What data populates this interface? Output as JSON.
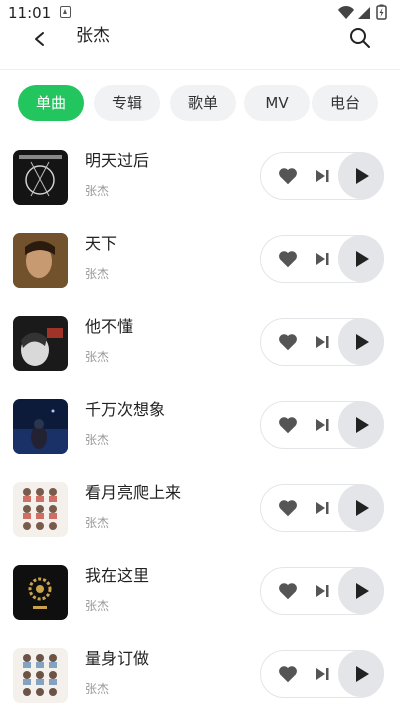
{
  "status": {
    "time": "11:01",
    "icons": [
      "app-notification-icon",
      "wifi-icon",
      "signal-icon",
      "battery-charging-icon"
    ]
  },
  "header": {
    "title": "张杰",
    "back_icon": "chevron-left-icon",
    "search_icon": "search-icon"
  },
  "tabs": [
    {
      "label": "单曲",
      "active": true
    },
    {
      "label": "专辑",
      "active": false
    },
    {
      "label": "歌单",
      "active": false
    },
    {
      "label": "MV",
      "active": false
    },
    {
      "label": "电台",
      "active": false
    }
  ],
  "songs": [
    {
      "title": "明天过后",
      "artist": "张杰"
    },
    {
      "title": "天下",
      "artist": "张杰"
    },
    {
      "title": "他不懂",
      "artist": "张杰"
    },
    {
      "title": "千万次想象",
      "artist": "张杰"
    },
    {
      "title": "看月亮爬上来",
      "artist": "张杰"
    },
    {
      "title": "我在这里",
      "artist": "张杰"
    },
    {
      "title": "量身订做",
      "artist": "张杰"
    }
  ],
  "colors": {
    "accent": "#22c55e",
    "tab_bg": "#f1f2f4",
    "control_bg": "#e4e5e8",
    "icon": "#555555"
  }
}
